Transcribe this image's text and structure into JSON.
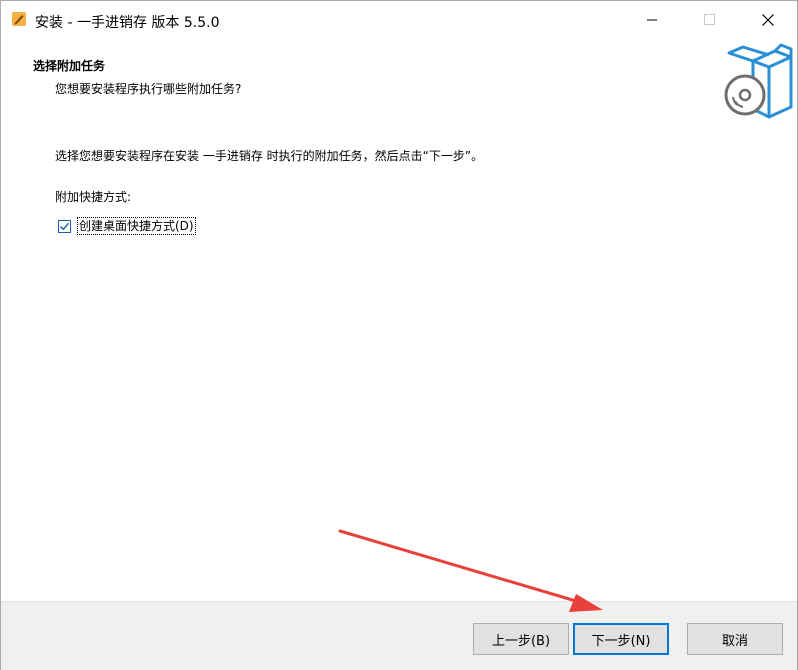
{
  "window": {
    "title": "安装 - 一手进销存 版本 5.5.0"
  },
  "header": {
    "title": "选择附加任务",
    "subtitle": "您想要安装程序执行哪些附加任务?"
  },
  "content": {
    "description": "选择您想要安装程序在安装 一手进销存 时执行的附加任务，然后点击“下一步”。",
    "group_label": "附加快捷方式:",
    "checkbox": {
      "label": "创建桌面快捷方式(D)",
      "checked": true
    }
  },
  "footer": {
    "back_label": "上一步(B)",
    "next_label": "下一步(N)",
    "cancel_label": "取消"
  },
  "colors": {
    "accent": "#0078d7",
    "annotation_arrow": "#e8403a",
    "footer_bg": "#f0f0f0"
  },
  "icons": {
    "app": "installer-pencil-icon",
    "header": "box-disc-icon"
  }
}
